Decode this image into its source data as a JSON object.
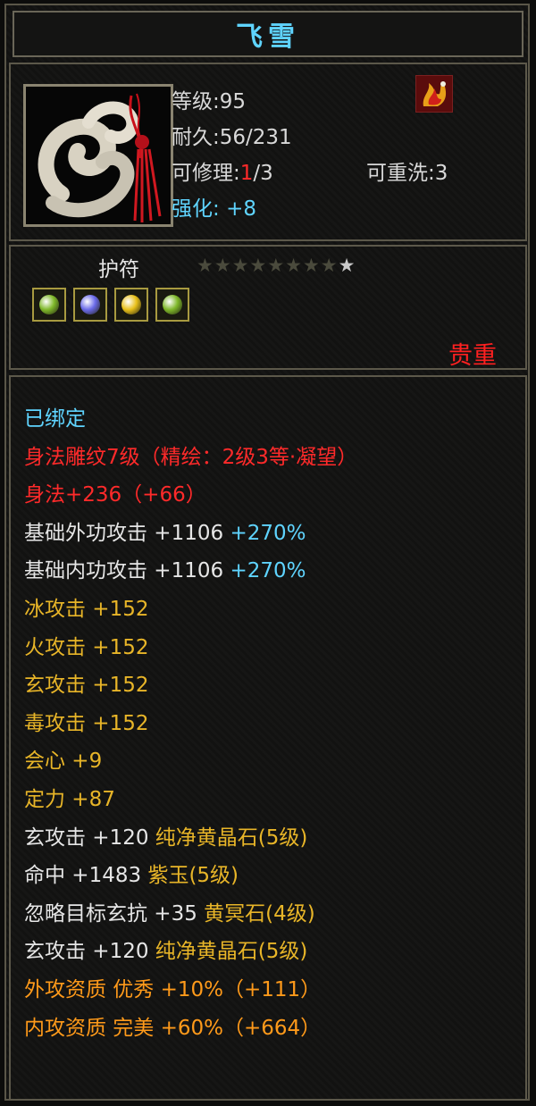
{
  "title": "飞雪",
  "info": {
    "level": "等级:95",
    "durability": "耐久:56/231",
    "repair_label": "可修理:",
    "repair_current": "1",
    "repair_max": "/3",
    "rewash": "可重洗:3",
    "enhance_label": "强化:",
    "enhance_value": "+8"
  },
  "amulet": {
    "label": "护符",
    "stars_filled": 8,
    "stars_total": 9,
    "gems": [
      {
        "icon": "green-gem-icon",
        "color": "#7fb82a"
      },
      {
        "icon": "purple-gem-icon",
        "color": "#6a6ae8"
      },
      {
        "icon": "yellow-gem-icon",
        "color": "#e8c01a"
      },
      {
        "icon": "green-gem-icon",
        "color": "#7fb82a"
      }
    ]
  },
  "rarity": "贵重",
  "colors": {
    "title": "#5fd4ff",
    "white": "#e6e6e6",
    "red": "#ff2a2a",
    "cyan": "#5fd4ff",
    "gold": "#e8b528",
    "orange": "#ff9a1a"
  },
  "attributes": [
    {
      "segments": [
        {
          "text": "已绑定",
          "color": "cyan"
        }
      ]
    },
    {
      "segments": [
        {
          "text": "身法雕纹7级（精绘：2级3等·凝望）",
          "color": "red"
        }
      ]
    },
    {
      "segments": [
        {
          "text": "身法+236（+66）",
          "color": "red"
        }
      ]
    },
    {
      "segments": [
        {
          "text": "基础外功攻击 +1106 ",
          "color": "white"
        },
        {
          "text": "+270%",
          "color": "cyan"
        }
      ]
    },
    {
      "segments": [
        {
          "text": "基础内功攻击 +1106 ",
          "color": "white"
        },
        {
          "text": "+270%",
          "color": "cyan"
        }
      ]
    },
    {
      "segments": [
        {
          "text": "冰攻击 +152",
          "color": "gold"
        }
      ]
    },
    {
      "segments": [
        {
          "text": "火攻击 +152",
          "color": "gold"
        }
      ]
    },
    {
      "segments": [
        {
          "text": "玄攻击 +152",
          "color": "gold"
        }
      ]
    },
    {
      "segments": [
        {
          "text": "毒攻击 +152",
          "color": "gold"
        }
      ]
    },
    {
      "segments": [
        {
          "text": "会心 +9",
          "color": "gold"
        }
      ]
    },
    {
      "segments": [
        {
          "text": "定力 +87",
          "color": "gold"
        }
      ]
    },
    {
      "segments": [
        {
          "text": "玄攻击 +120 ",
          "color": "white"
        },
        {
          "text": "纯净黄晶石(5级)",
          "color": "gold"
        }
      ]
    },
    {
      "segments": [
        {
          "text": "命中 +1483 ",
          "color": "white"
        },
        {
          "text": "紫玉(5级)",
          "color": "gold"
        }
      ]
    },
    {
      "segments": [
        {
          "text": "忽略目标玄抗 +35 ",
          "color": "white"
        },
        {
          "text": "黄冥石(4级)",
          "color": "gold"
        }
      ]
    },
    {
      "segments": [
        {
          "text": "玄攻击 +120 ",
          "color": "white"
        },
        {
          "text": "纯净黄晶石(5级)",
          "color": "gold"
        }
      ]
    },
    {
      "segments": [
        {
          "text": "外攻资质 优秀 +10%（+111）",
          "color": "orange"
        }
      ]
    },
    {
      "segments": [
        {
          "text": "内攻资质 完美 +60%（+664）",
          "color": "orange"
        }
      ]
    }
  ]
}
